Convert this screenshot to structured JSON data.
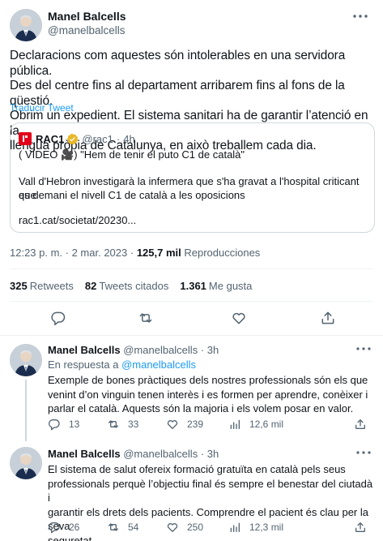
{
  "main_tweet": {
    "author_name": "Manel Balcells",
    "author_handle": "@manelbalcells",
    "text_lines": [
      "Declaracions com aquestes són intolerables en una servidora pública.",
      "Des del centre fins al departament arribarem fins al fons de la qüestió.",
      "Obrim un expedient. El sistema sanitari ha de garantir l’atenció en la",
      "llengua pròpia de Catalunya, en això treballem cada dia."
    ],
    "translate_label": "Traducir Tweet",
    "quote": {
      "name": "RAC1",
      "handle": "@rac1",
      "separator": "·",
      "time": "4h",
      "line1": "( VÍDEO 🎥) \"Hem de tenir el puto C1 de català\"",
      "line2": "Vall d'Hebron investigarà la infermera que s'ha gravat a l'hospital criticant que",
      "line3": "es demani el nivell C1 de català a les oposicions",
      "link": "rac1.cat/societat/20230..."
    },
    "timestamp": "12:23 p. m. · 2 mar. 2023 · ",
    "views_count": "125,7 mil",
    "views_label": " Reproducciones",
    "retweets_count": "325",
    "retweets_label": "Retweets",
    "quotes_count": "82",
    "quotes_label": "Tweets citados",
    "likes_count": "1.361",
    "likes_label": "Me gusta"
  },
  "replies": [
    {
      "author_name": "Manel Balcells",
      "author_handle": "@manelbalcells · 3h",
      "reply_prefix": "En respuesta a ",
      "reply_to": "@manelbalcells",
      "text_lines": [
        "Exemple de bones pràctiques dels nostres professionals són els que",
        "venint d’on vinguin tenen interès i es formen per aprendre, conèixer i",
        "parlar el català. Aquests són la majoria i els volem posar en valor."
      ],
      "replies": "13",
      "retweets": "33",
      "likes": "239",
      "views": "12,6 mil"
    },
    {
      "author_name": "Manel Balcells",
      "author_handle": "@manelbalcells · 3h",
      "text_lines": [
        "El sistema de salut ofereix formació gratuïta en català pels seus",
        "professionals perquè l’objectiu final és sempre el benestar del ciutadà i",
        "garantir els drets dels pacients. Comprendre el pacient és clau per la seva",
        "seguretat."
      ],
      "replies": "26",
      "retweets": "54",
      "likes": "250",
      "views": "12,3 mil"
    }
  ],
  "colors": {
    "text": "#0f1419",
    "secondary": "#536471",
    "link": "#1d9bf0",
    "divider": "#eff3f4",
    "verified": "#e8b829",
    "rac1_red": "#e2001a"
  },
  "icons": [
    "more-icon",
    "verified-icon",
    "reply-icon",
    "retweet-icon",
    "like-icon",
    "share-icon",
    "views-icon"
  ]
}
